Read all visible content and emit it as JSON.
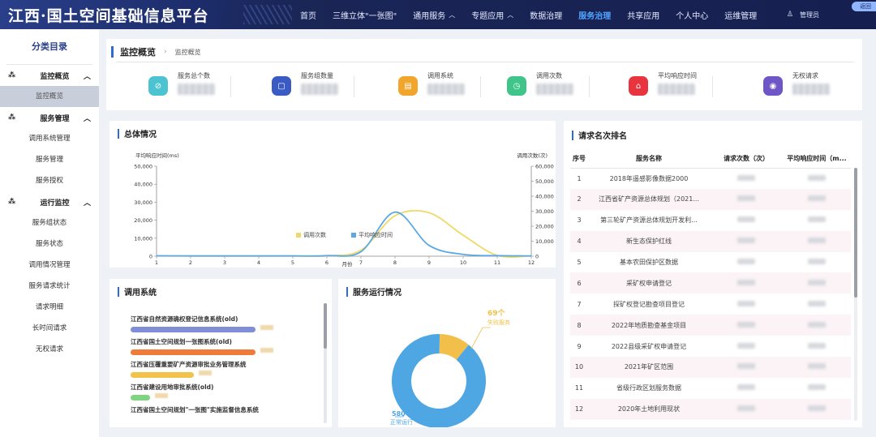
{
  "header": {
    "title": "江西·国土空间基础信息平台",
    "nav": [
      {
        "label": "首页",
        "caret": false,
        "active": false
      },
      {
        "label": "三维立体\"一张图\"",
        "caret": false,
        "active": false
      },
      {
        "label": "通用服务",
        "caret": true,
        "active": false
      },
      {
        "label": "专题应用",
        "caret": true,
        "active": false
      },
      {
        "label": "数据治理",
        "caret": false,
        "active": false
      },
      {
        "label": "服务治理",
        "caret": false,
        "active": true
      },
      {
        "label": "共享应用",
        "caret": false,
        "active": false
      },
      {
        "label": "个人中心",
        "caret": false,
        "active": false
      },
      {
        "label": "运维管理",
        "caret": false,
        "active": false
      }
    ],
    "user": "管理员",
    "corner": "返回"
  },
  "sidebar": {
    "title": "分类目录",
    "groups": [
      {
        "label": "监控概览",
        "items": [
          {
            "label": "监控概览",
            "active": true
          }
        ]
      },
      {
        "label": "服务管理",
        "items": [
          {
            "label": "调用系统管理"
          },
          {
            "label": "服务管理"
          },
          {
            "label": "服务授权"
          }
        ]
      },
      {
        "label": "运行监控",
        "items": [
          {
            "label": "服务组状态"
          },
          {
            "label": "服务状态"
          },
          {
            "label": "调用情况管理"
          },
          {
            "label": "服务请求统计"
          },
          {
            "label": "请求明细"
          },
          {
            "label": "长时间请求"
          },
          {
            "label": "无权请求"
          }
        ]
      }
    ]
  },
  "breadcrumb": {
    "title": "监控概览",
    "current": "监控概览"
  },
  "stats": [
    {
      "label": "服务总个数",
      "color": "#4cc3d1",
      "icon": "⊘"
    },
    {
      "label": "服务组数量",
      "color": "#3b5bc4",
      "icon": "▢"
    },
    {
      "label": "调用系统",
      "color": "#f1a52a",
      "icon": "▤"
    },
    {
      "label": "调用次数",
      "color": "#3fc58a",
      "icon": "◷"
    },
    {
      "label": "平均响应时间",
      "color": "#e8343f",
      "icon": "⌂"
    },
    {
      "label": "无权请求",
      "color": "#6e56c7",
      "icon": "◉"
    }
  ],
  "overview": {
    "title": "总体情况"
  },
  "chart_data": {
    "type": "line",
    "title": "总体情况",
    "xlabel": "月份",
    "ylabel_left": "平均响应时间(ms)",
    "ylabel_right": "调用次数(次)",
    "categories": [
      "1",
      "2",
      "3",
      "4",
      "5",
      "6",
      "7",
      "8",
      "9",
      "10",
      "11",
      "12"
    ],
    "x": [
      1,
      2,
      3,
      4,
      5,
      6,
      7,
      8,
      9,
      10,
      11,
      12
    ],
    "ylim_left": [
      0,
      50000
    ],
    "ylim_right": [
      0,
      60000
    ],
    "yticks_left": [
      "0",
      "10,000",
      "20,000",
      "30,000",
      "40,000",
      "50,000"
    ],
    "yticks_right": [
      "0",
      "10,000",
      "20,000",
      "30,000",
      "40,000",
      "50,000",
      "60,000"
    ],
    "series": [
      {
        "name": "调用次数",
        "axis": "right",
        "color": "#f0d966",
        "values": [
          200,
          150,
          150,
          150,
          200,
          300,
          4000,
          27000,
          29000,
          14000,
          500,
          200
        ]
      },
      {
        "name": "平均响应时间",
        "axis": "left",
        "color": "#5aa9e6",
        "values": [
          200,
          150,
          150,
          150,
          150,
          300,
          2500,
          24500,
          6000,
          1000,
          300,
          150
        ]
      }
    ],
    "legend_position": "bottom-right",
    "grid": false
  },
  "callsys": {
    "title": "调用系统",
    "items": [
      {
        "name": "江西省自然资源确权登记信息系统(old)",
        "color": "#7f8ed6",
        "frac": 0.83
      },
      {
        "name": "江西省国土空间规划一张图系统(old)",
        "color": "#ef7a3a",
        "frac": 0.83
      },
      {
        "name": "江西省压覆重要矿产资源审批业务管理系统",
        "color": "#f2c24a",
        "frac": 0.42
      },
      {
        "name": "江西省建设用地审批系统(old)",
        "color": "#7fd47f",
        "frac": 0.13
      },
      {
        "name": "江西省国土空间规划\"一张图\"实施监督信息系统",
        "color": "#e9b03d",
        "frac": 0.2
      }
    ]
  },
  "svcstat": {
    "title": "服务运行情况",
    "fail_label": "失败服务",
    "fail_value": 69,
    "fail_text": "69个",
    "ok_label": "正常运行",
    "ok_value": 580,
    "ok_text": "580个",
    "ok_color": "#4ea6e3",
    "fail_color": "#f2c04a"
  },
  "ranking": {
    "title": "请求名次排名",
    "columns": [
      "序号",
      "服务名称",
      "请求次数（次）",
      "平均响应时间（m..."
    ],
    "rows": [
      {
        "no": "1",
        "name": "2018年遥感影像数据2000"
      },
      {
        "no": "2",
        "name": "江西省矿产资源总体规划（2021..."
      },
      {
        "no": "3",
        "name": "第三轮矿产资源总体规划开发利..."
      },
      {
        "no": "4",
        "name": "新生态保护红线"
      },
      {
        "no": "5",
        "name": "基本农田保护区数据"
      },
      {
        "no": "6",
        "name": "采矿权申请登记"
      },
      {
        "no": "7",
        "name": "探矿权登记勘查项目登记"
      },
      {
        "no": "8",
        "name": "2022年地质勘查基金项目"
      },
      {
        "no": "9",
        "name": "2022县级采矿权申请登记"
      },
      {
        "no": "10",
        "name": "2021年矿区范围"
      },
      {
        "no": "11",
        "name": "省级行政区划服务数据"
      },
      {
        "no": "12",
        "name": "2020年土地利用现状"
      }
    ]
  }
}
